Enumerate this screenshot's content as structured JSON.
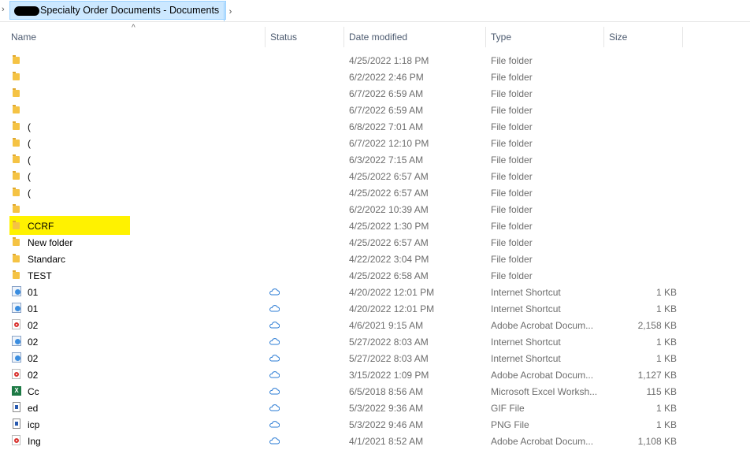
{
  "address_bar": {
    "path": "Specialty Order Documents - Documents",
    "left_chevron": "›",
    "right_chevron": "›"
  },
  "columns": {
    "name": "Name",
    "status": "Status",
    "date_modified": "Date modified",
    "type": "Type",
    "size": "Size",
    "sort_indicator": "^"
  },
  "highlight_color": "#fff200",
  "files": [
    {
      "name": "",
      "icon": "folder-icon",
      "status": "",
      "date": "4/25/2022 1:18 PM",
      "type": "File folder",
      "size": ""
    },
    {
      "name": "",
      "icon": "folder-icon",
      "status": "",
      "date": "6/2/2022 2:46 PM",
      "type": "File folder",
      "size": ""
    },
    {
      "name": "",
      "icon": "folder-icon",
      "status": "",
      "date": "6/7/2022 6:59 AM",
      "type": "File folder",
      "size": ""
    },
    {
      "name": "",
      "icon": "folder-icon",
      "status": "",
      "date": "6/7/2022 6:59 AM",
      "type": "File folder",
      "size": ""
    },
    {
      "name": "(",
      "icon": "folder-icon",
      "status": "",
      "date": "6/8/2022 7:01 AM",
      "type": "File folder",
      "size": ""
    },
    {
      "name": "(",
      "icon": "folder-icon",
      "status": "",
      "date": "6/7/2022 12:10 PM",
      "type": "File folder",
      "size": ""
    },
    {
      "name": "(",
      "icon": "folder-icon",
      "status": "",
      "date": "6/3/2022 7:15 AM",
      "type": "File folder",
      "size": ""
    },
    {
      "name": "(",
      "icon": "folder-icon",
      "status": "",
      "date": "4/25/2022 6:57 AM",
      "type": "File folder",
      "size": ""
    },
    {
      "name": "(",
      "icon": "folder-icon",
      "status": "",
      "date": "4/25/2022 6:57 AM",
      "type": "File folder",
      "size": ""
    },
    {
      "name": "",
      "icon": "folder-icon",
      "status": "",
      "date": "6/2/2022 10:39 AM",
      "type": "File folder",
      "size": ""
    },
    {
      "name": "CCRF",
      "icon": "folder-icon",
      "status": "",
      "date": "4/25/2022 1:30 PM",
      "type": "File folder",
      "size": "",
      "highlighted": true
    },
    {
      "name": "New folder",
      "icon": "folder-icon",
      "status": "",
      "date": "4/25/2022 6:57 AM",
      "type": "File folder",
      "size": ""
    },
    {
      "name": "Standarc",
      "icon": "folder-icon",
      "status": "",
      "date": "4/22/2022 3:04 PM",
      "type": "File folder",
      "size": ""
    },
    {
      "name": "TEST",
      "icon": "folder-icon",
      "status": "",
      "date": "4/25/2022 6:58 AM",
      "type": "File folder",
      "size": ""
    },
    {
      "name": "01",
      "icon": "internet-shortcut-icon",
      "status": "cloud-icon",
      "date": "4/20/2022 12:01 PM",
      "type": "Internet Shortcut",
      "size": "1 KB"
    },
    {
      "name": "01",
      "icon": "internet-shortcut-icon",
      "status": "cloud-icon",
      "date": "4/20/2022 12:01 PM",
      "type": "Internet Shortcut",
      "size": "1 KB"
    },
    {
      "name": "02",
      "icon": "pdf-icon",
      "status": "cloud-icon",
      "date": "4/6/2021 9:15 AM",
      "type": "Adobe Acrobat Docum...",
      "size": "2,158 KB"
    },
    {
      "name": "02",
      "icon": "internet-shortcut-icon",
      "status": "cloud-icon",
      "date": "5/27/2022 8:03 AM",
      "type": "Internet Shortcut",
      "size": "1 KB"
    },
    {
      "name": "02",
      "icon": "internet-shortcut-icon",
      "status": "cloud-icon",
      "date": "5/27/2022 8:03 AM",
      "type": "Internet Shortcut",
      "size": "1 KB"
    },
    {
      "name": "02",
      "icon": "pdf-icon",
      "status": "cloud-icon",
      "date": "3/15/2022 1:09 PM",
      "type": "Adobe Acrobat Docum...",
      "size": "1,127 KB"
    },
    {
      "name": "Cc",
      "icon": "excel-icon",
      "status": "cloud-icon",
      "date": "6/5/2018 8:56 AM",
      "type": "Microsoft Excel Worksh...",
      "size": "115 KB"
    },
    {
      "name": "ed",
      "icon": "image-icon",
      "status": "cloud-icon",
      "date": "5/3/2022 9:36 AM",
      "type": "GIF File",
      "size": "1 KB"
    },
    {
      "name": "icp",
      "icon": "image-icon",
      "status": "cloud-icon",
      "date": "5/3/2022 9:46 AM",
      "type": "PNG File",
      "size": "1 KB"
    },
    {
      "name": "Ing",
      "icon": "pdf-icon",
      "status": "cloud-icon",
      "date": "4/1/2021 8:52 AM",
      "type": "Adobe Acrobat Docum...",
      "size": "1,108 KB"
    }
  ]
}
